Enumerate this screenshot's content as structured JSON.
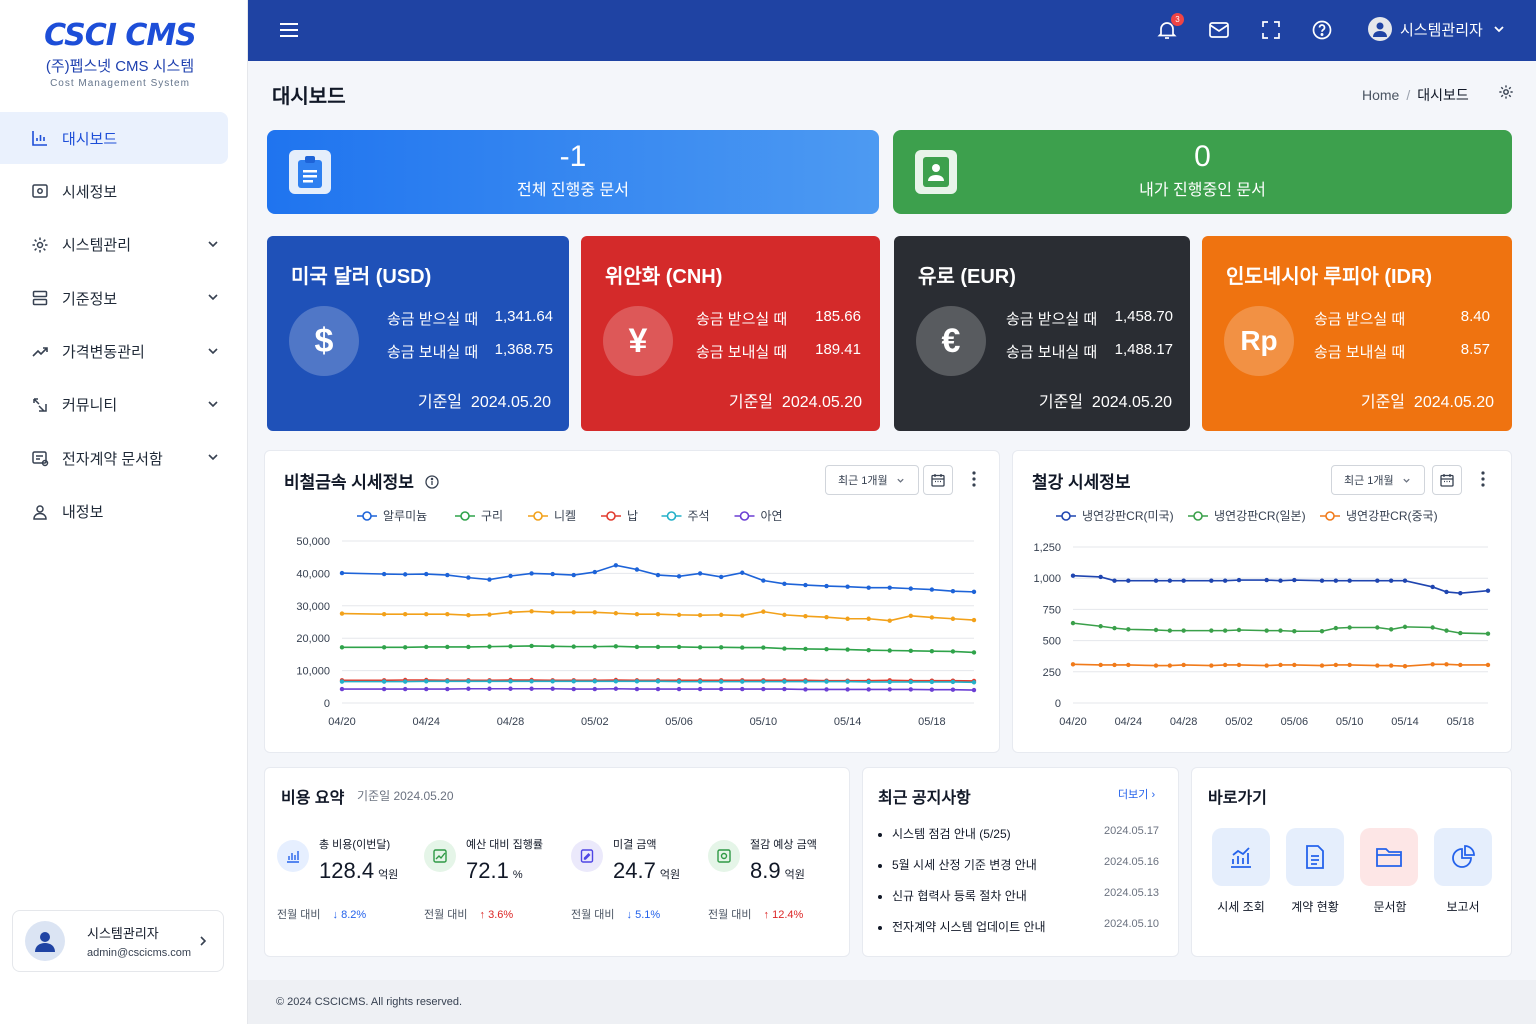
{
  "brand": {
    "logo": "CSCI CMS",
    "company": "(주)펩스넷 CMS 시스템",
    "tagline": "Cost Management System",
    "color": "#1d4ed8"
  },
  "sidebar": {
    "items": [
      {
        "label": "대시보드",
        "icon": "bar-chart-icon",
        "active": true
      },
      {
        "label": "시세정보",
        "icon": "price-board-icon"
      },
      {
        "label": "시스템관리",
        "icon": "gear-icon",
        "expandable": true
      },
      {
        "label": "기준정보",
        "icon": "server-icon",
        "expandable": true
      },
      {
        "label": "가격변동관리",
        "icon": "trend-up-icon",
        "expandable": true
      },
      {
        "label": "커뮤니티",
        "icon": "community-icon",
        "expandable": true
      },
      {
        "label": "전자계약 문서함",
        "icon": "contract-icon",
        "expandable": true
      },
      {
        "label": "내정보",
        "icon": "user-icon"
      }
    ],
    "user": {
      "name": "시스템관리자",
      "email": "admin@cscicms.com"
    }
  },
  "topbar": {
    "notification_count": "3",
    "user_name": "시스템관리자",
    "color": "#1f43a3"
  },
  "page": {
    "title": "대시보드",
    "breadcrumb": [
      "Home",
      "대시보드"
    ]
  },
  "stats": [
    {
      "value": "-1",
      "label": "전체 진행중 문서",
      "color": "#2f80f0"
    },
    {
      "value": "0",
      "label": "내가 진행중인 문서",
      "color": "#3da04d"
    }
  ],
  "fx": [
    {
      "title": "미국 달러 (USD)",
      "symbol": "$",
      "receive_label": "송금 받으실 때",
      "receive": "1,341.64",
      "send_label": "송금 보내실 때",
      "send": "1,368.75",
      "base_label": "기준일",
      "base_date": "2024.05.20",
      "color": "#1f51b8"
    },
    {
      "title": "위안화 (CNH)",
      "symbol": "¥",
      "receive_label": "송금 받으실 때",
      "receive": "185.66",
      "send_label": "송금 보내실 때",
      "send": "189.41",
      "base_label": "기준일",
      "base_date": "2024.05.20",
      "color": "#d42a2a"
    },
    {
      "title": "유로  (EUR)",
      "symbol": "€",
      "receive_label": "송금 받으실 때",
      "receive": "1,458.70",
      "send_label": "송금 보내실 때",
      "send": "1,488.17",
      "base_label": "기준일",
      "base_date": "2024.05.20",
      "color": "#2a2d33"
    },
    {
      "title": "인도네시아  루피아 (IDR)",
      "symbol": "Rp",
      "receive_label": "송금 받으실 때",
      "receive": "8.40",
      "send_label": "송금 보내실 때",
      "send": "8.57",
      "base_label": "기준일",
      "base_date": "2024.05.20",
      "color": "#ef7310"
    }
  ],
  "nonferrous": {
    "title": "비철금속 시세정보",
    "period": "최근 1개월"
  },
  "steel": {
    "title": "철강 시세정보",
    "period": "최근 1개월"
  },
  "chart_data": [
    {
      "type": "line",
      "title": "비철금속 시세정보",
      "x": [
        "04/20",
        "04/22",
        "04/23",
        "04/24",
        "04/25",
        "04/26",
        "04/27",
        "04/28",
        "04/29",
        "04/30",
        "05/01",
        "05/02",
        "05/03",
        "05/04",
        "05/05",
        "05/06",
        "05/07",
        "05/08",
        "05/09",
        "05/10",
        "05/11",
        "05/12",
        "05/13",
        "05/14",
        "05/15",
        "05/16",
        "05/17",
        "05/18",
        "05/19",
        "05/20"
      ],
      "xticks": [
        "04/20",
        "04/24",
        "04/28",
        "05/02",
        "05/06",
        "05/10",
        "05/14",
        "05/18"
      ],
      "ylim": [
        0,
        50000
      ],
      "yticks": [
        "0",
        "10,000",
        "20,000",
        "30,000",
        "40,000",
        "50,000"
      ],
      "legend": "top",
      "series": [
        {
          "name": "알루미늄",
          "color": "#1d63d8",
          "values": [
            40100,
            39800,
            39700,
            39800,
            39500,
            38700,
            38100,
            39200,
            40000,
            39800,
            39500,
            40400,
            42500,
            41200,
            39500,
            39100,
            40000,
            38900,
            40200,
            37800,
            36800,
            36400,
            36100,
            35900,
            35600,
            35600,
            35300,
            35000,
            34500,
            34300
          ]
        },
        {
          "name": "구리",
          "color": "#2fa34a",
          "values": [
            17200,
            17200,
            17200,
            17300,
            17300,
            17300,
            17400,
            17500,
            17600,
            17500,
            17400,
            17400,
            17500,
            17300,
            17300,
            17300,
            17200,
            17200,
            17100,
            17100,
            16800,
            16700,
            16600,
            16500,
            16300,
            16200,
            16100,
            16000,
            15900,
            15600
          ]
        },
        {
          "name": "니켈",
          "color": "#f2a11a",
          "values": [
            27600,
            27400,
            27400,
            27400,
            27400,
            27100,
            27300,
            28000,
            28300,
            28000,
            28000,
            28000,
            27700,
            27400,
            27400,
            27200,
            27100,
            27200,
            27000,
            28200,
            27200,
            26800,
            26500,
            26000,
            26000,
            25400,
            26900,
            26400,
            26000,
            25600
          ]
        },
        {
          "name": "납",
          "color": "#e23b2e",
          "values": [
            7000,
            7000,
            7100,
            7100,
            7000,
            7000,
            7000,
            7100,
            7100,
            7000,
            7000,
            7000,
            7100,
            7000,
            7000,
            7000,
            7000,
            7000,
            7000,
            7000,
            7000,
            7000,
            6900,
            6900,
            6900,
            7000,
            6900,
            6900,
            6900,
            6800
          ]
        },
        {
          "name": "주석",
          "color": "#23b0c8",
          "values": [
            6600,
            6600,
            6600,
            6700,
            6700,
            6700,
            6700,
            6700,
            6700,
            6700,
            6700,
            6700,
            6700,
            6700,
            6700,
            6600,
            6600,
            6600,
            6600,
            6600,
            6600,
            6600,
            6600,
            6600,
            6500,
            6500,
            6500,
            6500,
            6500,
            6400
          ]
        },
        {
          "name": "아연",
          "color": "#6b3fd4",
          "values": [
            4300,
            4300,
            4300,
            4300,
            4300,
            4400,
            4400,
            4400,
            4400,
            4400,
            4300,
            4300,
            4400,
            4300,
            4300,
            4300,
            4300,
            4300,
            4300,
            4300,
            4300,
            4200,
            4200,
            4200,
            4200,
            4200,
            4200,
            4100,
            4100,
            4000
          ]
        }
      ]
    },
    {
      "type": "line",
      "title": "철강 시세정보",
      "x": [
        "04/20",
        "04/22",
        "04/23",
        "04/24",
        "04/26",
        "04/27",
        "04/28",
        "04/30",
        "05/01",
        "05/02",
        "05/04",
        "05/05",
        "05/06",
        "05/08",
        "05/09",
        "05/10",
        "05/12",
        "05/13",
        "05/14",
        "05/16",
        "05/17",
        "05/18",
        "05/20"
      ],
      "xticks": [
        "04/20",
        "04/24",
        "04/28",
        "05/02",
        "05/06",
        "05/10",
        "05/14",
        "05/18"
      ],
      "ylim": [
        0,
        1250
      ],
      "yticks": [
        "0",
        "250",
        "500",
        "750",
        "1,000",
        "1,250"
      ],
      "legend": "top",
      "series": [
        {
          "name": "냉연강판CR(미국)",
          "color": "#1f45b0",
          "values": [
            1020,
            1010,
            980,
            980,
            980,
            980,
            980,
            980,
            980,
            985,
            985,
            980,
            985,
            980,
            980,
            980,
            980,
            980,
            980,
            930,
            890,
            880,
            900
          ]
        },
        {
          "name": "냉연강판CR(일본)",
          "color": "#3aa04a",
          "values": [
            640,
            615,
            600,
            590,
            585,
            580,
            580,
            580,
            580,
            585,
            580,
            580,
            575,
            575,
            600,
            605,
            605,
            590,
            610,
            605,
            580,
            560,
            555
          ]
        },
        {
          "name": "냉연강판CR(중국)",
          "color": "#f07a1a",
          "values": [
            310,
            305,
            305,
            305,
            300,
            300,
            305,
            300,
            305,
            305,
            300,
            305,
            305,
            300,
            305,
            305,
            300,
            300,
            295,
            310,
            310,
            305,
            305
          ]
        }
      ]
    }
  ],
  "cost_summary": {
    "title": "비용 요약",
    "base_date": "기준일 2024.05.20",
    "items": [
      {
        "label": "총 비용(이번달)",
        "value": "128.4",
        "unit": "억원",
        "compare_label": "전월 대비",
        "change": "8.2%",
        "direction": "down"
      },
      {
        "label": "예산 대비 집행률",
        "value": "72.1",
        "unit": "%",
        "compare_label": "전월 대비",
        "change": "3.6%",
        "direction": "up"
      },
      {
        "label": "미결 금액",
        "value": "24.7",
        "unit": "억원",
        "compare_label": "전월 대비",
        "change": "5.1%",
        "direction": "down"
      },
      {
        "label": "절감 예상 금액",
        "value": "8.9",
        "unit": "억원",
        "compare_label": "전월 대비",
        "change": "12.4%",
        "direction": "up"
      }
    ]
  },
  "notices": {
    "title": "최근 공지사항",
    "more": "더보기",
    "items": [
      {
        "title": "시스템 점검 안내 (5/25)",
        "date": "2024.05.17"
      },
      {
        "title": "5월 시세 산정 기준 변경 안내",
        "date": "2024.05.16"
      },
      {
        "title": "신규 협력사 등록 절차 안내",
        "date": "2024.05.13"
      },
      {
        "title": "전자계약 시스템 업데이트 안내",
        "date": "2024.05.10"
      }
    ]
  },
  "quick_links": {
    "title": "바로가기",
    "items": [
      {
        "label": "시세 조회",
        "icon": "chart-icon"
      },
      {
        "label": "계약 현황",
        "icon": "document-icon"
      },
      {
        "label": "문서함",
        "icon": "folder-icon"
      },
      {
        "label": "보고서",
        "icon": "report-icon"
      }
    ]
  },
  "footer": {
    "text": "© 2024 CSCICMS. All rights reserved."
  }
}
